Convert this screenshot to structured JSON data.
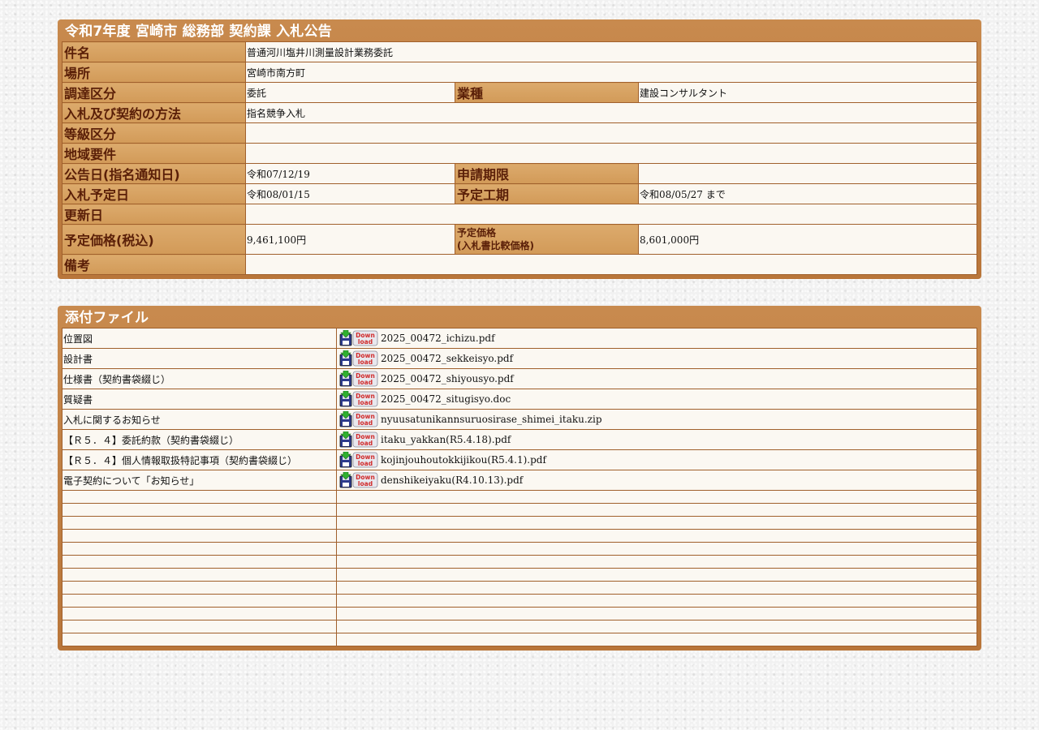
{
  "notice": {
    "title": "令和7年度 宮崎市 総務部 契約課 入札公告",
    "rows": {
      "subject_label": "件名",
      "subject": "普通河川塩井川測量設計業務委託",
      "location_label": "場所",
      "location": "宮崎市南方町",
      "procurement_label": "調達区分",
      "procurement": "委託",
      "industry_label": "業種",
      "industry": "建設コンサルタント",
      "method_label": "入札及び契約の方法",
      "method": "指名競争入札",
      "grade_label": "等級区分",
      "grade": "",
      "region_label": "地域要件",
      "region": "",
      "announce_label": "公告日(指名通知日)",
      "announce": "令和07/12/19",
      "deadline_label": "申請期限",
      "deadline": "",
      "bid_date_label": "入札予定日",
      "bid_date": "令和08/01/15",
      "period_label": "予定工期",
      "period": "令和08/05/27 まで",
      "updated_label": "更新日",
      "updated": "",
      "price_label": "予定価格(税込)",
      "price": "9,461,100円",
      "compare_label_1": "予定価格",
      "compare_label_2": "(入札書比較価格)",
      "compare": "8,601,000円",
      "notes_label": "備考",
      "notes": ""
    }
  },
  "attachments": {
    "title": "添付ファイル",
    "icon": "download-icon",
    "files": [
      {
        "name": "位置図",
        "file": "2025_00472_ichizu.pdf"
      },
      {
        "name": "設計書",
        "file": "2025_00472_sekkeisyo.pdf"
      },
      {
        "name": "仕様書（契約書袋綴じ）",
        "file": "2025_00472_shiyousyo.pdf"
      },
      {
        "name": "質疑書",
        "file": "2025_00472_situgisyo.doc"
      },
      {
        "name": "入札に関するお知らせ",
        "file": "nyuusatunikannsuruosirase_shimei_itaku.zip"
      },
      {
        "name": "【Ｒ５．４】委託約款（契約書袋綴じ）",
        "file": "itaku_yakkan(R5.4.18).pdf"
      },
      {
        "name": "【Ｒ５．４】個人情報取扱特記事項（契約書袋綴じ）",
        "file": "kojinjouhoutokkijikou(R5.4.1).pdf"
      },
      {
        "name": "電子契約について「お知らせ」",
        "file": "denshikeiyaku(R4.10.13).pdf"
      }
    ],
    "empty_rows": 12
  },
  "colors": {
    "panel": "#c0803f",
    "label_bg": "#d8a263",
    "label_text": "#5a1f08",
    "cell_bg": "#fbf8f2"
  }
}
